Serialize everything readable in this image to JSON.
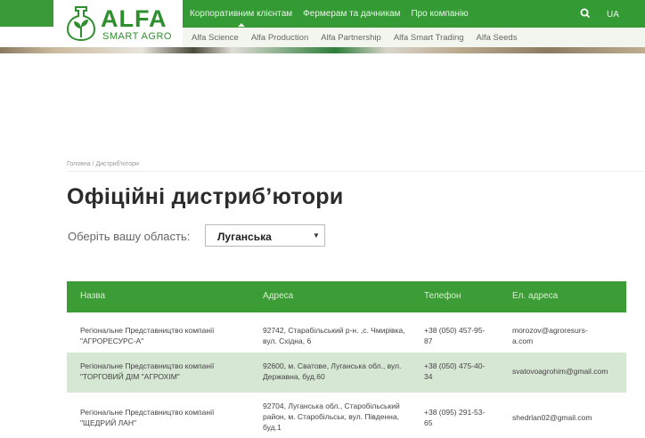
{
  "logo": {
    "title": "ALFA",
    "subtitle": "SMART AGRO"
  },
  "main_nav": [
    {
      "label": "Корпоративним клієнтам",
      "active": true
    },
    {
      "label": "Фермерам та дачникам",
      "active": false
    },
    {
      "label": "Про компанію",
      "active": false
    }
  ],
  "lang": "UA",
  "sub_nav": [
    "Alfa Science",
    "Alfa Production",
    "Alfa Partnership",
    "Alfa Smart Trading",
    "Alfa Seeds"
  ],
  "breadcrumb": {
    "home": "Головна",
    "separator": "/",
    "current": "Дистриб'ютори"
  },
  "page_title": "Офіційні дистриб’ютори",
  "region": {
    "label": "Оберіть вашу область:",
    "selected": "Луганська"
  },
  "table": {
    "headers": [
      "Назва",
      "Адреса",
      "Телефон",
      "Ел. адреса"
    ],
    "rows": [
      {
        "name": "Регіональне Представництво компанії \"АГРОРЕСУРС-А\"",
        "address": "92742, Старабільський р-н. ,с. Чмирівка, вул. Східна, 6",
        "phone": "+38 (050) 457-95-87",
        "email": "morozov@agroresurs-a.com"
      },
      {
        "name": "Регіональне Представництво компанії \"ТОРГОВИЙ ДІМ \"АГРОХІМ\"",
        "address": "92600, м. Сватове, Луганська обл., вул. Державна, буд.60",
        "phone": "+38 (050) 475-40-34",
        "email": "svatovoagrohim@gmail.com"
      },
      {
        "name": "Регіональне Представництво компанії \"ЩЕДРИЙ ЛАН\"",
        "address": "92704, Луганська обл., Старобільський район, м. Старобільськ, вул. Південна, буд.1",
        "phone": "+38 (095) 291-53-65",
        "email": "shedrlan02@gmail.com"
      }
    ]
  },
  "colors": {
    "brand_green": "#3c9c36",
    "row_alt": "#d6e7d3"
  },
  "icons": {
    "logo": "plant-sprout-icon",
    "search": "search-icon",
    "select_caret": "caret-down-icon"
  }
}
